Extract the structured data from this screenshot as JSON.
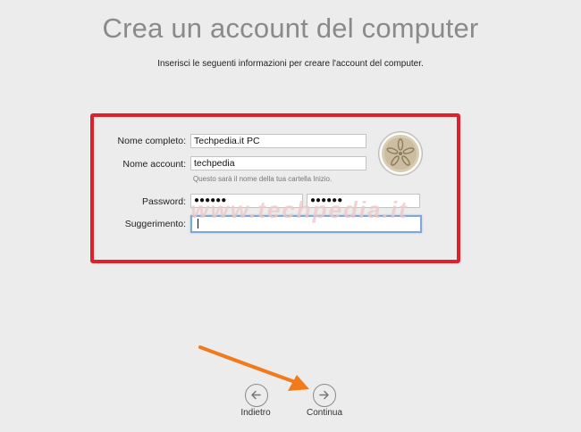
{
  "title": "Crea un account del computer",
  "subtitle": "Inserisci le seguenti informazioni per creare l'account del computer.",
  "form": {
    "full_name_label": "Nome completo:",
    "full_name_value": "Techpedia.it PC",
    "account_name_label": "Nome account:",
    "account_name_value": "techpedia",
    "account_hint": "Questo sarà il nome della tua cartella Inizio.",
    "password_label": "Password:",
    "password_value": "●●●●●●",
    "password_verify_value": "●●●●●●",
    "hint_label": "Suggerimento:",
    "hint_value": ""
  },
  "watermark": "www.techpedia.it",
  "nav": {
    "back_label": "Indietro",
    "continue_label": "Continua"
  },
  "colors": {
    "highlight_box": "#e0202b",
    "arrow": "#f07a1c",
    "title": "#8a8a8a"
  },
  "icons": {
    "back": "arrow-left-circle-icon",
    "continue": "arrow-right-circle-icon",
    "avatar": "sand-dollar-avatar-icon"
  }
}
